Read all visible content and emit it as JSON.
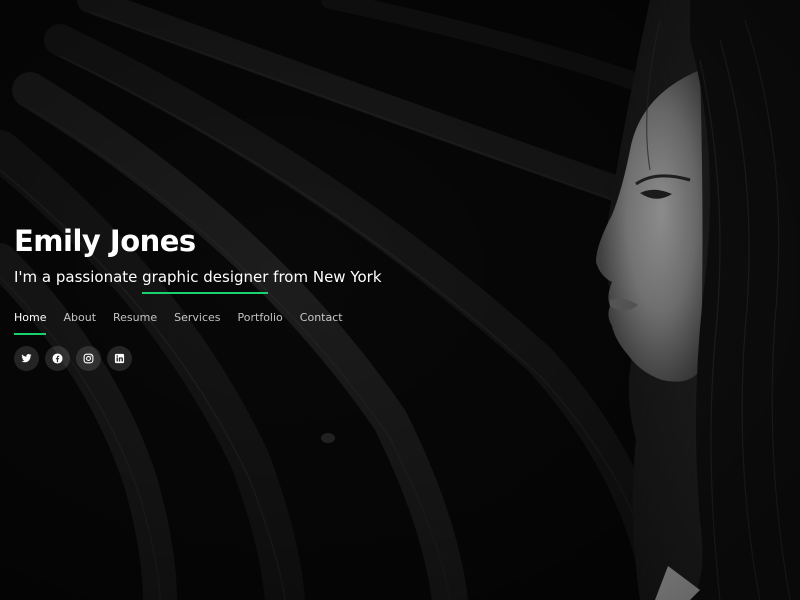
{
  "hero": {
    "name": "Emily Jones",
    "tagline_prefix": "I'm a passionate ",
    "tagline_highlight": "graphic designer",
    "tagline_suffix": " from New York"
  },
  "nav": {
    "items": [
      {
        "label": "Home",
        "active": true
      },
      {
        "label": "About",
        "active": false
      },
      {
        "label": "Resume",
        "active": false
      },
      {
        "label": "Services",
        "active": false
      },
      {
        "label": "Portfolio",
        "active": false
      },
      {
        "label": "Contact",
        "active": false
      }
    ]
  },
  "socials": [
    {
      "icon": "twitter-icon"
    },
    {
      "icon": "facebook-icon"
    },
    {
      "icon": "instagram-icon"
    },
    {
      "icon": "linkedin-icon"
    }
  ],
  "colors": {
    "accent": "#18d26e",
    "background": "#0a0a0a",
    "text": "#ffffff"
  }
}
